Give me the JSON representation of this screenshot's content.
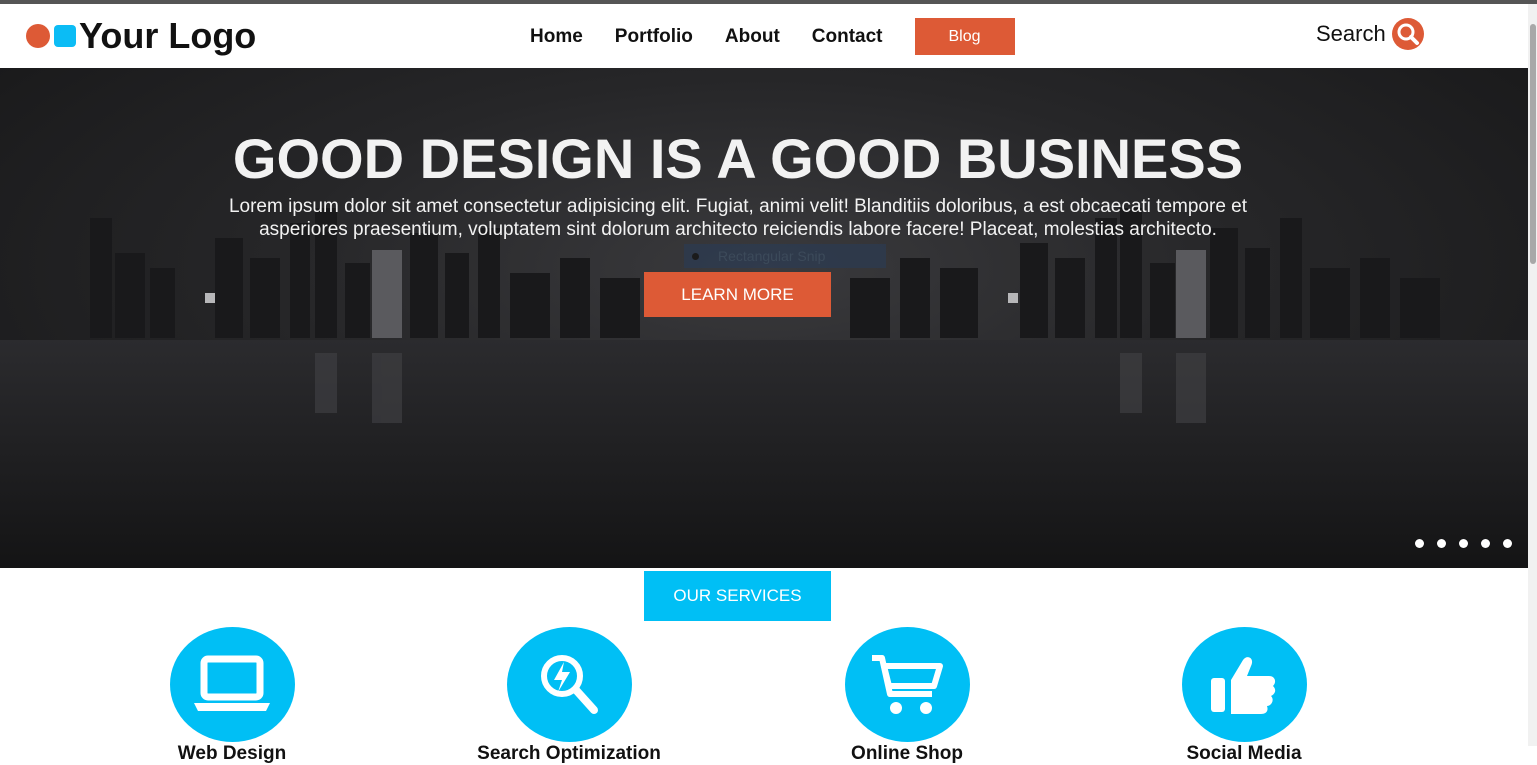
{
  "brand": {
    "logo_text": "Your Logo",
    "accent": "#dd5a36",
    "secondary": "#0bbcf5"
  },
  "nav": {
    "links": [
      "Home",
      "Portfolio",
      "About",
      "Contact"
    ],
    "blog_label": "Blog"
  },
  "search": {
    "label": "Search",
    "icon": "search-icon"
  },
  "hero": {
    "title": "GOOD DESIGN IS A GOOD BUSINESS",
    "text": "Lorem ipsum dolor sit amet consectetur adipisicing elit. Fugiat, animi velit! Blanditiis doloribus, a est obcaecati tempore et asperiores praesentium, voluptatem sint dolorum architecto reiciendis labore facere! Placeat, molestias architecto.",
    "button_label": "LEARN MORE",
    "overlay_label": "Rectangular Snip",
    "slide_count": 5
  },
  "services": {
    "button_label": "OUR SERVICES",
    "accent": "#00bff5",
    "items": [
      {
        "title": "Web Design",
        "icon": "laptop-icon"
      },
      {
        "title": "Search Optimization",
        "icon": "search-bolt-icon"
      },
      {
        "title": "Online Shop",
        "icon": "cart-icon"
      },
      {
        "title": "Social Media",
        "icon": "thumbs-up-icon"
      }
    ]
  }
}
